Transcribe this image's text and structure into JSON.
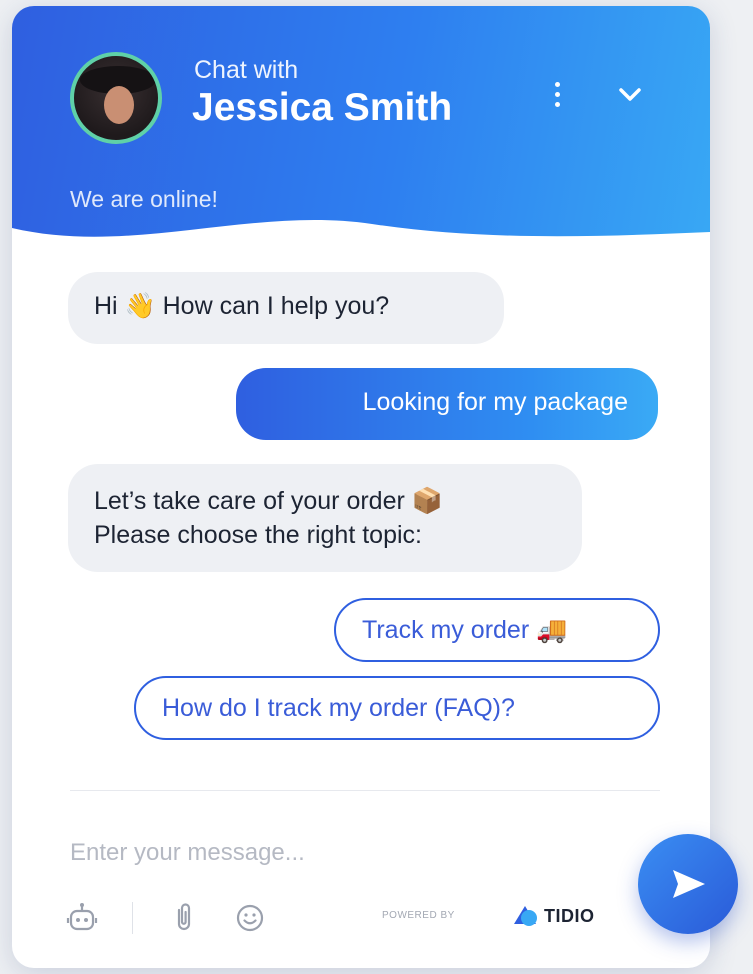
{
  "header": {
    "chat_with": "Chat with",
    "agent_name": "Jessica Smith",
    "status": "We are online!",
    "icons": {
      "menu": "more-vertical-icon",
      "collapse": "chevron-down-icon"
    }
  },
  "messages": [
    {
      "from": "agent",
      "text": "Hi 👋 How can I help you?"
    },
    {
      "from": "user",
      "text": "Looking for my package"
    },
    {
      "from": "agent",
      "lines": [
        "Let’s take care of your order 📦",
        "Please choose the right topic:"
      ]
    }
  ],
  "quick_replies": [
    {
      "label": "Track my order 🚚"
    },
    {
      "label": "How do I track my order (FAQ)?"
    }
  ],
  "composer": {
    "placeholder": "Enter your message...",
    "tools": [
      "bot-icon",
      "paperclip-icon",
      "smiley-icon"
    ],
    "send_icon": "send-icon"
  },
  "footer": {
    "powered_by": "POWERED BY",
    "brand": "TIDIO"
  },
  "colors": {
    "primary": "#2f5fe0",
    "gradient_end": "#38a8f4",
    "bubble_bg": "#eef0f4",
    "online_ring": "#5fd1a8"
  }
}
